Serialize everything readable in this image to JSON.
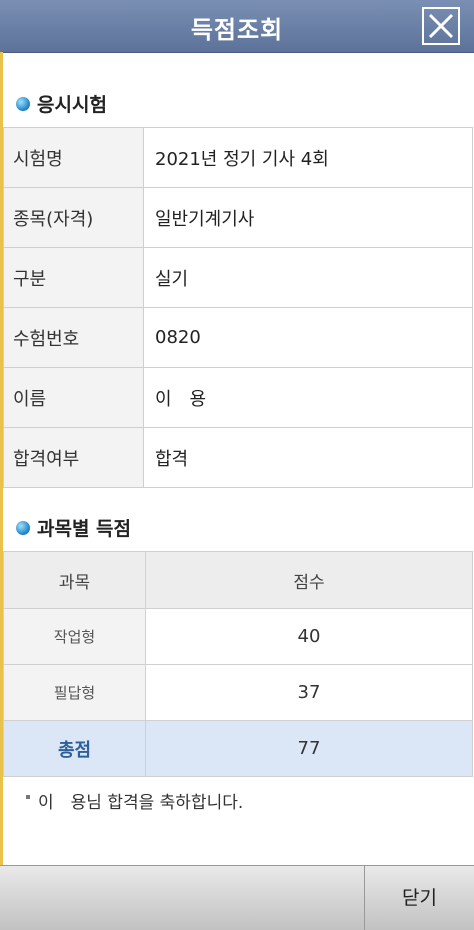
{
  "header": {
    "title": "득점조회"
  },
  "sections": {
    "exam_title": "응시시험",
    "score_title": "과목별 득점"
  },
  "info_rows": [
    {
      "label": "시험명",
      "value": "2021년 정기 기사 4회"
    },
    {
      "label": "종목(자격)",
      "value": "일반기계기사"
    },
    {
      "label": "구분",
      "value": "실기"
    },
    {
      "label": "수험번호",
      "value": "0820"
    },
    {
      "label": "이름",
      "value": "이　용"
    },
    {
      "label": "합격여부",
      "value": "합격"
    }
  ],
  "score_table": {
    "headers": [
      "과목",
      "점수"
    ],
    "rows": [
      {
        "subject": "작업형",
        "score": "40"
      },
      {
        "subject": "필답형",
        "score": "37"
      }
    ],
    "total_label": "총점",
    "total_score": "77"
  },
  "message": "이　용님 합격을 축하합니다.",
  "footer": {
    "close_label": "닫기"
  }
}
